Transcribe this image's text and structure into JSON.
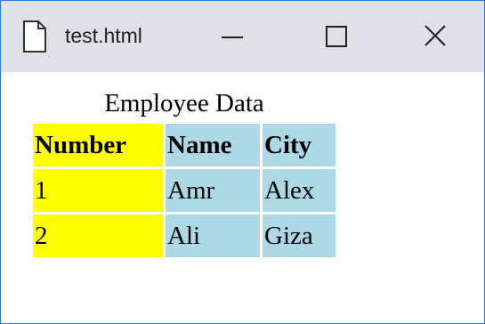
{
  "window": {
    "title": "test.html",
    "icons": {
      "page": "page-icon",
      "minimize": "minimize-icon",
      "maximize": "maximize-icon",
      "close": "close-icon"
    }
  },
  "table": {
    "caption": "Employee Data",
    "headers": [
      "Number",
      "Name",
      "City"
    ],
    "rows": [
      [
        "1",
        "Amr",
        "Alex"
      ],
      [
        "2",
        "Ali",
        "Giza"
      ]
    ],
    "colors": {
      "number_column": "#ffff00",
      "other_columns": "#add8e6",
      "window_border": "#2b79d6",
      "titlebar": "#dee1e6"
    }
  }
}
